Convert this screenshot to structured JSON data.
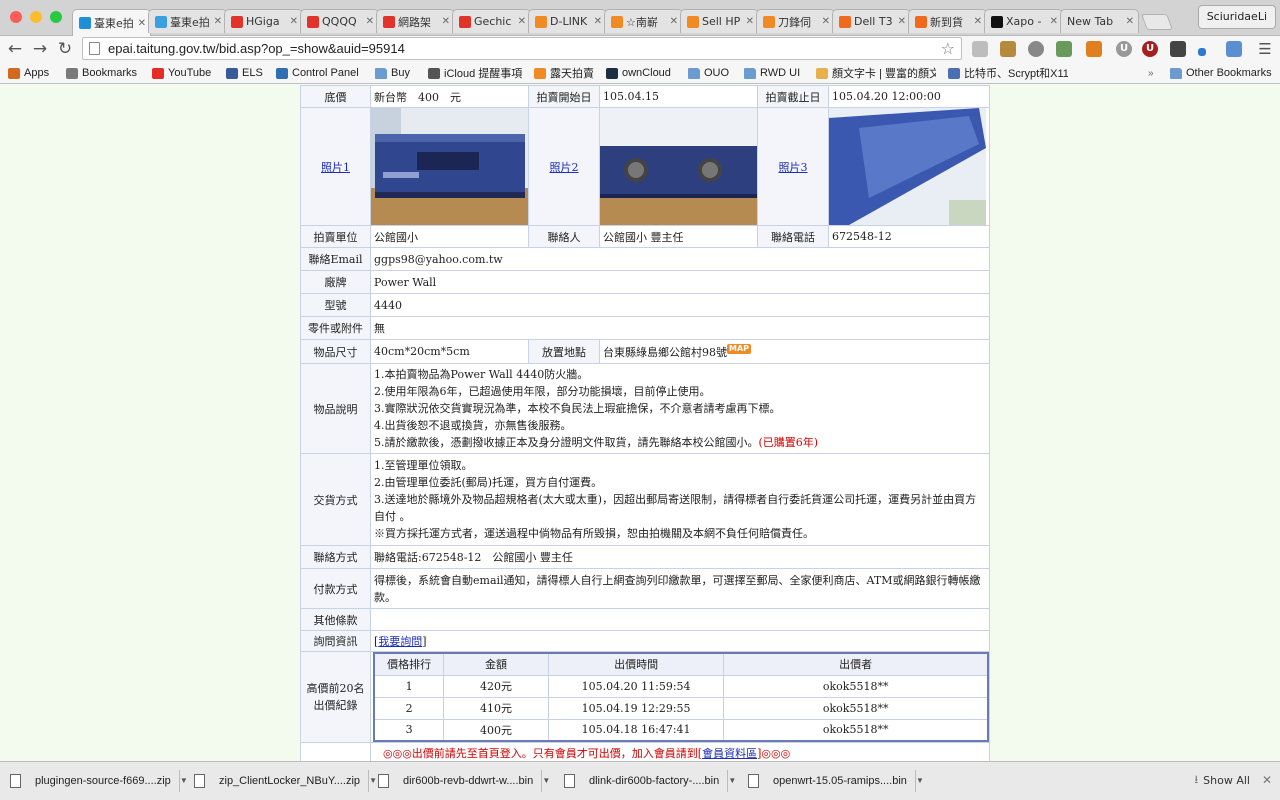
{
  "tabs": [
    {
      "label": "臺東e拍",
      "color": "#1f8fd6"
    },
    {
      "label": "臺東e拍",
      "color": "#3aa0e0"
    },
    {
      "label": "HGiga",
      "color": "#e0342b"
    },
    {
      "label": "QQQQ",
      "color": "#e0342b"
    },
    {
      "label": "網路架",
      "color": "#e0342b"
    },
    {
      "label": "Gechic",
      "color": "#e0342b"
    },
    {
      "label": "D-LINK",
      "color": "#f08a24"
    },
    {
      "label": "☆南嶄",
      "color": "#f08a24"
    },
    {
      "label": "Sell HP",
      "color": "#f08a24"
    },
    {
      "label": "刀鋒伺",
      "color": "#f08a24"
    },
    {
      "label": "Dell T3",
      "color": "#f06a1e"
    },
    {
      "label": "新到貨",
      "color": "#f06a1e"
    },
    {
      "label": "Xapo -",
      "color": "#111111"
    },
    {
      "label": "New Tab",
      "color": ""
    }
  ],
  "profile_name": "SciuridaeLi",
  "url": "epai.taitung.gov.tw/bid.asp?op_=show&auid=95914",
  "bookmarks": [
    {
      "label": "Apps",
      "icon": "apps-grid-icon"
    },
    {
      "label": "Bookmarks",
      "icon": "bookmarks-icon"
    },
    {
      "label": "YouTube",
      "icon": "youtube-icon"
    },
    {
      "label": "ELS",
      "icon": "facebook-icon"
    },
    {
      "label": "Control Panel",
      "icon": "control-panel-icon"
    },
    {
      "label": "Buy",
      "icon": "folder-icon"
    },
    {
      "label": "iCloud 提醒事項",
      "icon": "apple-icon"
    },
    {
      "label": "露天拍賣",
      "icon": "ruten-icon"
    },
    {
      "label": "ownCloud",
      "icon": "cloud-icon"
    },
    {
      "label": "OUO",
      "icon": "folder-icon"
    },
    {
      "label": "RWD UI",
      "icon": "folder-icon"
    },
    {
      "label": "顏文字卡 | 豐富的顏文",
      "icon": "page-icon"
    },
    {
      "label": "比特币、Scrypt和X11",
      "icon": "page-icon"
    },
    {
      "label": "Other Bookmarks",
      "icon": "folder-icon"
    }
  ],
  "auction": {
    "base_price_label": "底價",
    "base_price": "新台幣　400　元",
    "start_label": "拍賣開始日",
    "start_date": "105.04.15",
    "end_label": "拍賣截止日",
    "end_date": "105.04.20 12:00:00",
    "photo1": "照片1",
    "photo2": "照片2",
    "photo3": "照片3",
    "unit_label": "拍賣單位",
    "unit": "公館國小",
    "contact_person_label": "聯絡人",
    "contact_person": "公館國小 豐主任",
    "phone_label": "聯絡電話",
    "phone": "672548-12",
    "email_label": "聯絡Email",
    "email": "ggps98@yahoo.com.tw",
    "brand_label": "廠牌",
    "brand": "Power Wall",
    "model_label": "型號",
    "model": "4440",
    "accessories_label": "零件或附件",
    "accessories": "無",
    "size_label": "物品尺寸",
    "size": "40cm*20cm*5cm",
    "location_label": "放置地點",
    "location": "台東縣綠島鄉公館村98號",
    "map_badge": "MAP",
    "desc_label": "物品說明",
    "desc": [
      "1.本拍賣物品為Power Wall 4440防火牆。",
      "2.使用年限為6年，已超過使用年限，部分功能損壞，目前停止使用。",
      "3.實際狀況依交貨實現況為準，本校不負民法上瑕疵擔保，不介意者請考慮再下標。",
      "4.出貨後恕不退或換貨，亦無售後服務。",
      "5.請於繳款後，憑劃撥收據正本及身分證明文件取貨，請先聯絡本校公館國小。"
    ],
    "desc_purchase_note": "(已購置6年)",
    "delivery_label": "交貨方式",
    "delivery": [
      "1.至管理單位領取。",
      "2.由管理單位委託(郵局)托運，買方自付運費。",
      "3.送達地於縣境外及物品超規格者(太大或太重)，因超出郵局寄送限制，請得標者自行委託貨運公司托運，運費另計並由買方自付 。",
      "※買方採托運方式者，運送過程中倘物品有所毀損，恕由拍機關及本網不負任何賠償責任。"
    ],
    "contact_method_label": "聯絡方式",
    "contact_method": "聯絡電話:672548-12　公館國小 豐主任",
    "payment_label": "付款方式",
    "payment": "得標後，系統會自動email通知，請得標人自行上網查詢列印繳款單，可選擇至郵局、全家便利商店、ATM或網路銀行轉帳繳款。",
    "other_terms_label": "其他條款",
    "other_terms": "",
    "inquiry_label": "詢問資訊",
    "inquiry_link": "我要詢問",
    "history_label": "高價前20名出價紀錄",
    "bid_headers": [
      "價格排行",
      "金額",
      "出價時間",
      "出價者"
    ],
    "bids": [
      {
        "rank": "1",
        "amount": "420元",
        "time": "105.04.20 11:59:54",
        "bidder": "okok5518**"
      },
      {
        "rank": "2",
        "amount": "410元",
        "time": "105.04.19 12:29:55",
        "bidder": "okok5518**"
      },
      {
        "rank": "3",
        "amount": "400元",
        "time": "105.04.18 16:47:41",
        "bidder": "okok5518**"
      }
    ],
    "notice_prefix": "◎◎◎出價前請先至首頁登入。只有會員才可出價，加入會員請到[",
    "notice_link": "會員資料區",
    "notice_suffix": "]◎◎◎"
  },
  "downloads": [
    "plugingen-source-f669....zip",
    "zip_ClientLocker_NBuY....zip",
    "dir600b-revb-ddwrt-w....bin",
    "dlink-dir600b-factory-....bin",
    "openwrt-15.05-ramips....bin"
  ],
  "show_all": "Show All"
}
